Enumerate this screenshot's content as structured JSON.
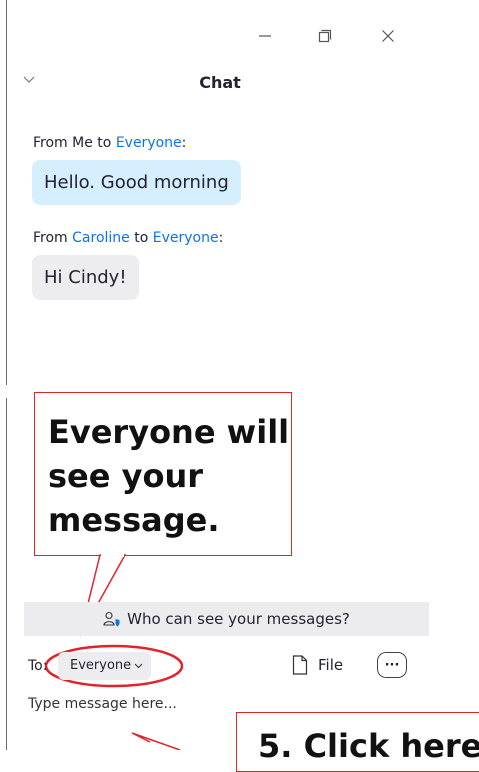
{
  "window": {
    "title": "Chat"
  },
  "messages": [
    {
      "from_prefix": "From",
      "sender": "Me",
      "to_word": "to",
      "recipient": "Everyone",
      "text": "Hello. Good morning"
    },
    {
      "from_prefix": "From",
      "sender": "Caroline",
      "to_word": "to",
      "recipient": "Everyone",
      "text": "Hi Cindy!"
    }
  ],
  "callout": {
    "text": "Everyone will see your message."
  },
  "callout_step": {
    "text": "5. Click here"
  },
  "who_can_see": {
    "label": "Who can see your messages?"
  },
  "composer": {
    "to_label": "To:",
    "to_value": "Everyone",
    "file_label": "File",
    "more_label": "···",
    "placeholder": "Type message here..."
  },
  "colors": {
    "highlight_red": "#e0242c",
    "link_blue": "#0e72ed",
    "my_bubble": "#d6efff",
    "other_bubble": "#ededf0"
  }
}
